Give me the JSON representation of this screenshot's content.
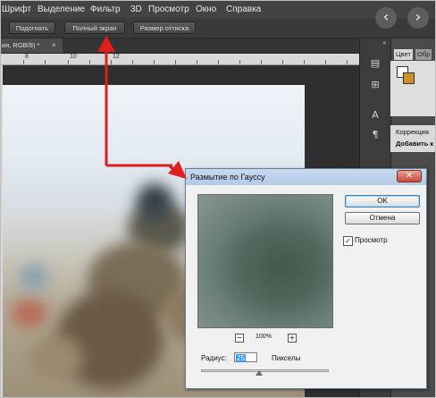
{
  "menubar": {
    "items": [
      "Шрифт",
      "Выделение",
      "Фильтр",
      "3D",
      "Просмотр",
      "Окно",
      "Справка"
    ]
  },
  "options_bar": {
    "buttons": [
      "Подогнать",
      "Полный экран",
      "Размер оттиска"
    ]
  },
  "nav": {
    "back_icon": "‹",
    "forward_icon": "›"
  },
  "document": {
    "tab_label": "ия, RGB/8) *",
    "tab_close": "×",
    "ruler_marks": [
      "8",
      "10",
      "12"
    ]
  },
  "panels": {
    "collapse_icon": "«",
    "tabs": [
      "Цвет",
      "Обр"
    ],
    "correction_title": "Коррекция",
    "correction_subtitle": "Добавить к"
  },
  "dialog": {
    "title": "Размытие по Гауссу",
    "close_icon": "✕",
    "ok_label": "OK",
    "cancel_label": "Отмена",
    "preview_checked_mark": "✓",
    "preview_label": "Просмотр",
    "zoom_out": "−",
    "zoom_in": "+",
    "zoom_level": "100%",
    "radius_label": "Радиус:",
    "radius_value": "25",
    "units": "Пикселы"
  },
  "colors": {
    "annotation_red": "#e01e1e",
    "menubar": "#434343",
    "dialog_titlebar": "#b9cfea",
    "background_swatch": "#cf8f2a"
  }
}
